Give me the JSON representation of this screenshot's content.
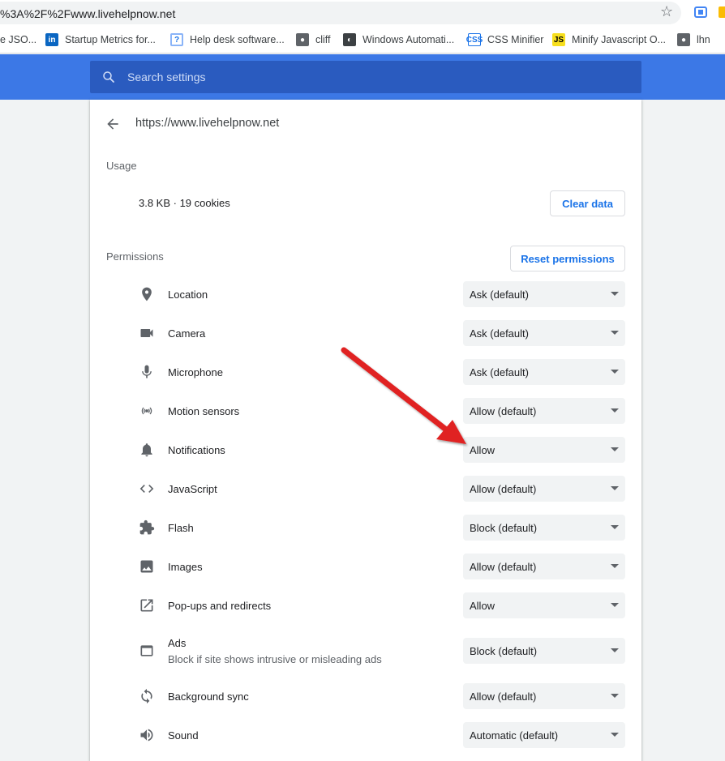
{
  "browser": {
    "address": "%3A%2F%2Fwww.livehelpnow.net",
    "bookmarks": [
      {
        "label": "e JSO...",
        "icon": "none"
      },
      {
        "label": "Startup Metrics for...",
        "icon": "linkedin-icon"
      },
      {
        "label": "Help desk software...",
        "icon": "helpdesk-icon"
      },
      {
        "label": "cliff",
        "icon": "globe-icon"
      },
      {
        "label": "Windows Automati...",
        "icon": "windows-automation-icon"
      },
      {
        "label": "CSS Minifier",
        "icon": "css-icon"
      },
      {
        "label": "Minify Javascript O...",
        "icon": "js-icon"
      },
      {
        "label": "lhn",
        "icon": "globe-icon"
      }
    ]
  },
  "search": {
    "placeholder": "Search settings"
  },
  "site": {
    "url": "https://www.livehelpnow.net"
  },
  "usage": {
    "label": "Usage",
    "summary": "3.8 KB · 19 cookies",
    "clear_label": "Clear data"
  },
  "permissions": {
    "label": "Permissions",
    "reset_label": "Reset permissions",
    "items": [
      {
        "name": "Location",
        "value": "Ask (default)",
        "icon": "location-pin-icon"
      },
      {
        "name": "Camera",
        "value": "Ask (default)",
        "icon": "camera-icon"
      },
      {
        "name": "Microphone",
        "value": "Ask (default)",
        "icon": "microphone-icon"
      },
      {
        "name": "Motion sensors",
        "value": "Allow (default)",
        "icon": "motion-sensors-icon"
      },
      {
        "name": "Notifications",
        "value": "Allow",
        "icon": "bell-icon"
      },
      {
        "name": "JavaScript",
        "value": "Allow (default)",
        "icon": "code-brackets-icon"
      },
      {
        "name": "Flash",
        "value": "Block (default)",
        "icon": "puzzle-piece-icon"
      },
      {
        "name": "Images",
        "value": "Allow (default)",
        "icon": "image-icon"
      },
      {
        "name": "Pop-ups and redirects",
        "value": "Allow",
        "icon": "open-in-new-icon"
      },
      {
        "name": "Ads",
        "sub": "Block if site shows intrusive or misleading ads",
        "value": "Block (default)",
        "icon": "ad-window-icon"
      },
      {
        "name": "Background sync",
        "value": "Allow (default)",
        "icon": "sync-icon"
      },
      {
        "name": "Sound",
        "value": "Automatic (default)",
        "icon": "speaker-icon"
      }
    ]
  },
  "colors": {
    "header_blue": "#3c78e6",
    "accent": "#1a73e8",
    "annotation_arrow": "#e02020"
  }
}
